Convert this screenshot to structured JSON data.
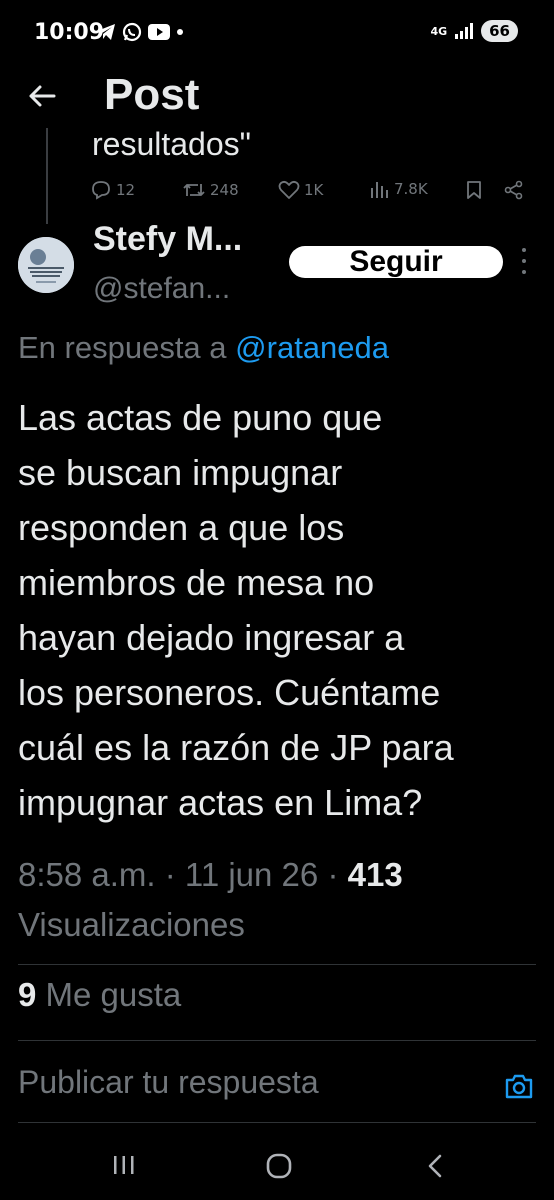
{
  "status_bar": {
    "time": "10:09",
    "network_label": "4G",
    "battery": "66"
  },
  "header": {
    "title": "Post"
  },
  "previous_post": {
    "text_tail": "resultados\"",
    "replies": "12",
    "reposts": "248",
    "likes": "1K",
    "views": "7.8K"
  },
  "author": {
    "name": "Stefy M...",
    "handle": "@stefan...",
    "follow_label": "Seguir"
  },
  "reply_context": {
    "prefix": "En respuesta a",
    "mention": "@rataneda"
  },
  "tweet": {
    "lines": [
      "Las actas de puno que",
      "se buscan impugnar",
      "responden a que los",
      "miembros de mesa no",
      "hayan dejado ingresar a",
      "los personeros. Cuéntame",
      "cuál es la razón de JP para",
      "impugnar actas en Lima?"
    ],
    "time": "8:58 a.m.",
    "date": "11 jun 26",
    "views_count": "413",
    "views_label": "Visualizaciones"
  },
  "likes": {
    "count": "9",
    "label": "Me gusta"
  },
  "composer": {
    "placeholder": "Publicar tu respuesta"
  },
  "colors": {
    "background": "#000000",
    "text": "#e7e9ea",
    "secondary": "#71767b",
    "accent": "#1d9bf0"
  }
}
